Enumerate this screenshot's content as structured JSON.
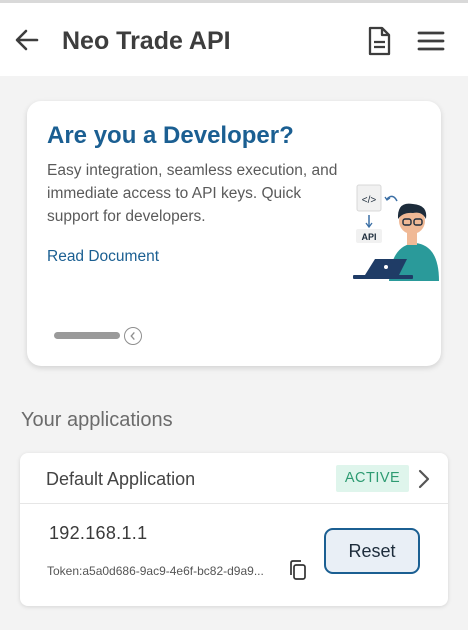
{
  "header": {
    "title": "Neo Trade API",
    "back_icon": "arrow-left-icon",
    "doc_icon": "document-icon",
    "menu_icon": "hamburger-menu-icon"
  },
  "banner": {
    "heading": "Are you a Developer?",
    "description": "Easy integration, seamless execution, and immediate access to API keys. Quick support for developers.",
    "link": "Read Document",
    "illustration_code": "</>",
    "illustration_api": "API",
    "illustration": "developer-at-laptop-illustration"
  },
  "applications": {
    "section_title": "Your applications",
    "items": [
      {
        "name": "Default Application",
        "status": "ACTIVE",
        "ip": "192.168.1.1",
        "token": "Token:a5a0d686-9ac9-4e6f-bc82-d9a9...",
        "reset_label": "Reset"
      }
    ]
  },
  "colors": {
    "accent": "#1b5f92",
    "active_bg": "#dff5ec",
    "active_text": "#2e9b72"
  }
}
